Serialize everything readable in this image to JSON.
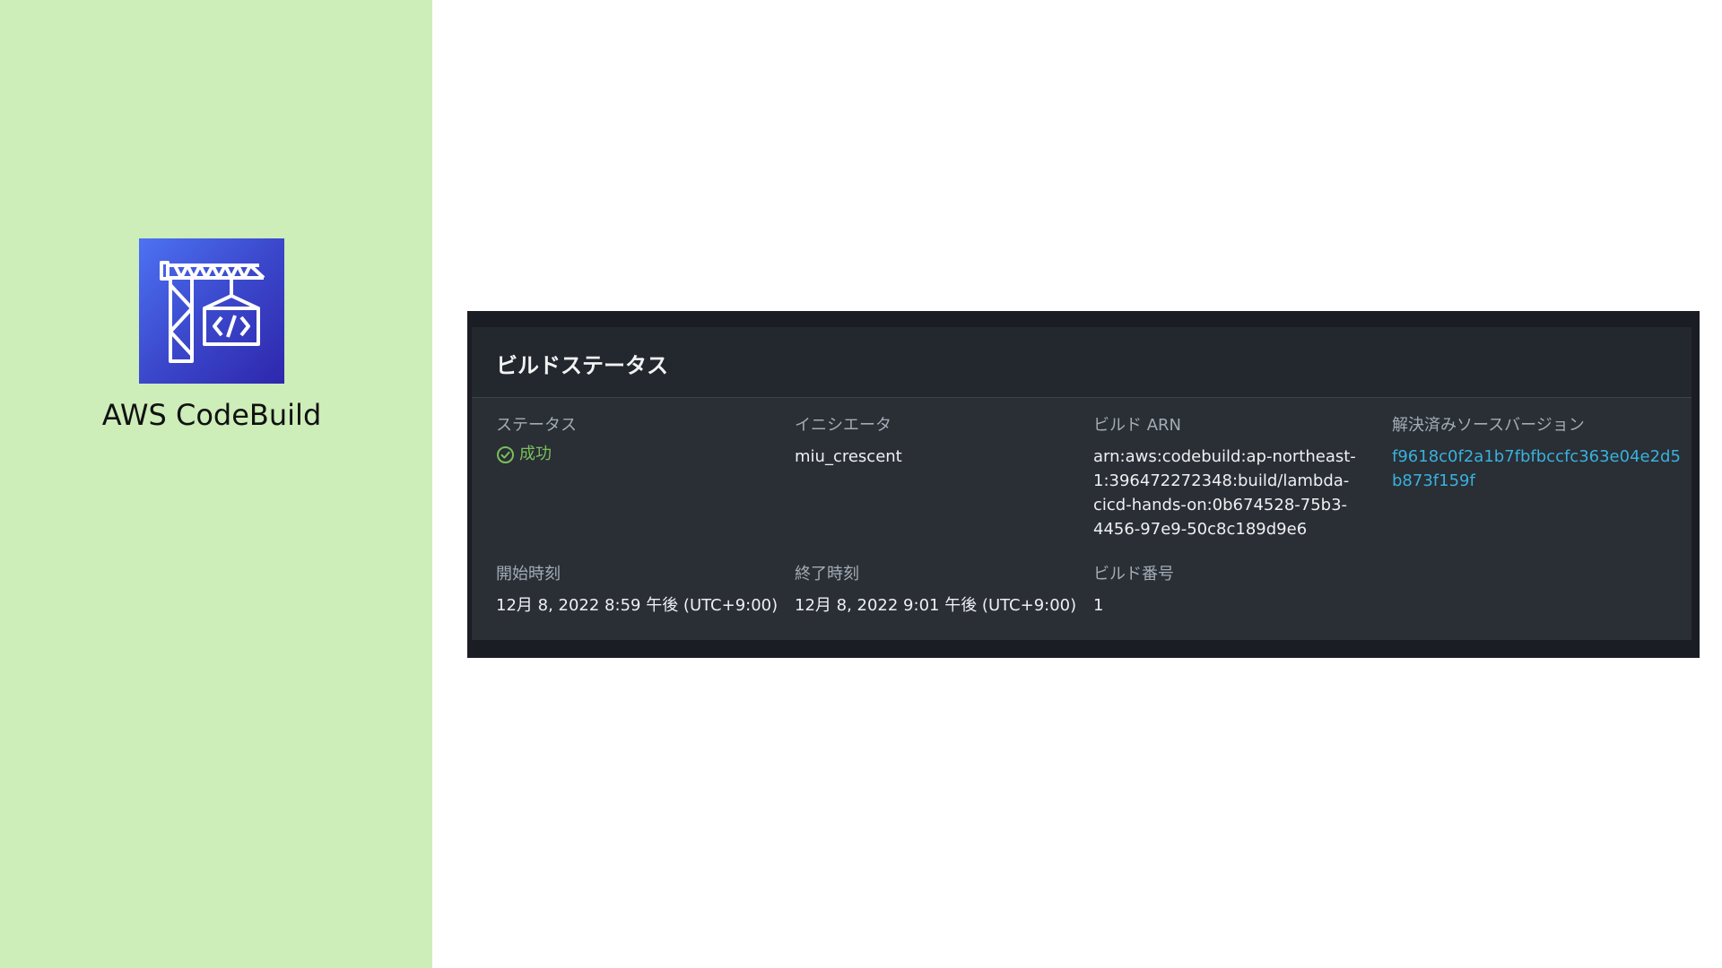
{
  "product": {
    "name": "AWS CodeBuild",
    "icon": "codebuild-crane-icon",
    "tile_colors": [
      "#4d72f3",
      "#2e27ad"
    ]
  },
  "panel": {
    "title": "ビルドステータス",
    "fields": {
      "status": {
        "label": "ステータス",
        "value": "成功",
        "icon": "success-check-icon",
        "color": "#79c05a"
      },
      "initiator": {
        "label": "イニシエータ",
        "value": "miu_crescent"
      },
      "build_arn": {
        "label": "ビルド ARN",
        "lines": [
          "arn:aws:codebuild:ap-northeast-",
          "1:396472272348:build/lambda-",
          "cicd-hands-on:0b674528-75b3-",
          "4456-97e9-50c8c189d9e6"
        ]
      },
      "resolved_source_version": {
        "label": "解決済みソースバージョン",
        "lines": [
          "f9618c0f2a1b7fbfbccfc363e04e2d5",
          "b873f159f"
        ],
        "color": "#38b2dc"
      },
      "start_time": {
        "label": "開始時刻",
        "value": "12月 8, 2022 8:59 午後 (UTC+9:00)"
      },
      "end_time": {
        "label": "終了時刻",
        "value": "12月 8, 2022 9:01 午後 (UTC+9:00)"
      },
      "build_number": {
        "label": "ビルド番号",
        "value": "1"
      }
    }
  }
}
